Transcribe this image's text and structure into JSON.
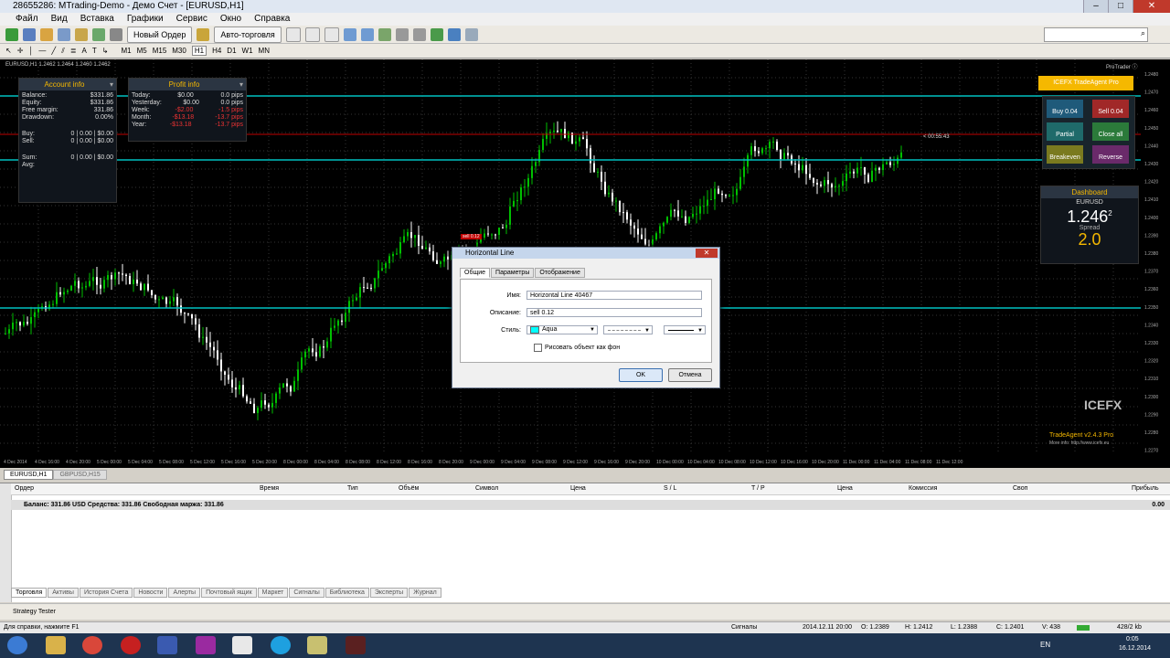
{
  "window": {
    "title": "28655286: MTrading-Demo - Демо Счет - [EURUSD,H1]",
    "min": "–",
    "max": "□",
    "close": "✕"
  },
  "menu": [
    "Файл",
    "Вид",
    "Вставка",
    "Графики",
    "Сервис",
    "Окно",
    "Справка"
  ],
  "toolbar": {
    "new_order": "Новый Ордер",
    "auto_trading": "Авто-торговля"
  },
  "timeframes": [
    "M1",
    "M5",
    "M15",
    "M30",
    "H1",
    "H4",
    "D1",
    "W1",
    "MN"
  ],
  "chart": {
    "symbol_header": "EURUSD,H1 1.2462 1.2464 1.2460 1.2462",
    "pro_trader_label": "ProTrader ⓘ",
    "countdown": "< 00:55:43",
    "price_ticks": [
      "1.2480",
      "1.2470",
      "1.2460",
      "1.2450",
      "1.2440",
      "1.2430",
      "1.2420",
      "1.2410",
      "1.2400",
      "1.2390",
      "1.2380",
      "1.2370",
      "1.2360",
      "1.2350",
      "1.2340",
      "1.2330",
      "1.2320",
      "1.2310",
      "1.2300",
      "1.2290",
      "1.2280",
      "1.2270"
    ],
    "time_ticks": [
      "4 Dec 2014",
      "4 Dec 16:00",
      "4 Dec 20:00",
      "5 Dec 00:00",
      "5 Dec 04:00",
      "5 Dec 08:00",
      "5 Dec 12:00",
      "5 Dec 16:00",
      "5 Dec 20:00",
      "8 Dec 00:00",
      "8 Dec 04:00",
      "8 Dec 08:00",
      "8 Dec 12:00",
      "8 Dec 16:00",
      "8 Dec 20:00",
      "9 Dec 00:00",
      "9 Dec 04:00",
      "9 Dec 08:00",
      "9 Dec 12:00",
      "9 Dec 16:00",
      "9 Dec 20:00",
      "10 Dec 00:00",
      "10 Dec 04:00",
      "10 Dec 08:00",
      "10 Dec 12:00",
      "10 Dec 16:00",
      "10 Dec 20:00",
      "11 Dec 00:00",
      "11 Dec 04:00",
      "11 Dec 08:00",
      "11 Dec 12:00"
    ],
    "line_tag": "sell 0.12",
    "watermark": "ICEFX",
    "tradeagent_version": "TradeAgent v2.4.3 Pro",
    "tradeagent_url": "More info: http://www.icefx.eu",
    "colors": {
      "bull": "#00c000",
      "bear": "#ffffff",
      "hline": "#00c0c0",
      "redline": "#c00000",
      "accent": "#f5b800"
    }
  },
  "account_info": {
    "title": "Account info",
    "rows": [
      {
        "label": "Balance:",
        "value": "$331.86"
      },
      {
        "label": "Equity:",
        "value": "$331.86"
      },
      {
        "label": "Free margin:",
        "value": "331.86"
      },
      {
        "label": "Drawdown:",
        "value": "0.00%"
      }
    ],
    "buy": {
      "label": "Buy:",
      "value": "0 | 0.00 | $0.00"
    },
    "sell": {
      "label": "Sell:",
      "value": "0 | 0.00 | $0.00"
    },
    "sum": {
      "label": "Sum:",
      "value": "0 | 0.00 | $0.00"
    },
    "avg": {
      "label": "Avg:",
      "value": ""
    }
  },
  "profit_info": {
    "title": "Profit info",
    "rows": [
      {
        "label": "Today:",
        "value": "$0.00",
        "pips": "0.0 pips"
      },
      {
        "label": "Yesterday:",
        "value": "$0.00",
        "pips": "0.0 pips"
      },
      {
        "label": "Week:",
        "value": "-$2.00",
        "pips": "-1.5 pips"
      },
      {
        "label": "Month:",
        "value": "-$13.18",
        "pips": "-13.7 pips"
      },
      {
        "label": "Year:",
        "value": "-$13.18",
        "pips": "-13.7 pips"
      }
    ]
  },
  "trade_panel": {
    "header": "ICEFX TradeAgent Pro",
    "buy": "Buy 0.04",
    "sell": "Sell 0.04",
    "partial": "Partial",
    "close_all": "Close all",
    "breakeven": "Breakeven",
    "reverse": "Reverse"
  },
  "dashboard": {
    "title": "Dashboard",
    "symbol": "EURUSD",
    "price": "1.246",
    "price_small": "2",
    "spread_label": "Spread",
    "spread": "2.0"
  },
  "dialog": {
    "title": "Horizontal Line",
    "tabs": [
      "Общие",
      "Параметры",
      "Отображение"
    ],
    "name_label": "Имя:",
    "name_value": "Horizontal Line 40467",
    "desc_label": "Описание:",
    "desc_value": "sell 0.12",
    "style_label": "Стиль:",
    "color_name": "Aqua",
    "background_label": "Рисовать объект как фон",
    "ok": "OK",
    "cancel": "Отмена"
  },
  "chart_tabs": [
    "EURUSD,H1",
    "GBPUSD,H15"
  ],
  "terminal": {
    "columns": [
      "Ордер",
      "Время",
      "Тип",
      "Объём",
      "Символ",
      "Цена",
      "S / L",
      "T / P",
      "Цена",
      "Комиссия",
      "Своп",
      "Прибыль"
    ],
    "balance_line": "Баланс: 331.86 USD  Средства: 331.86  Свободная маржа: 331.86",
    "profit": "0.00",
    "tabs": [
      "Торговля",
      "Активы",
      "История Счета",
      "Новости",
      "Алерты",
      "Почтовый ящик",
      "Маркет",
      "Сигналы",
      "Библиотека",
      "Эксперты",
      "Журнал"
    ],
    "strategy_tester": "Strategy Tester"
  },
  "status": {
    "help": "Для справки, нажмите F1",
    "signals": "Сигналы",
    "datetime": "2014.12.11 20:00",
    "open": "O: 1.2389",
    "high": "H: 1.2412",
    "low": "L: 1.2388",
    "close": "C: 1.2401",
    "volume": "V: 438",
    "traffic": "428/2 kb"
  },
  "taskbar": {
    "lang": "EN",
    "time": "0:05",
    "date": "16.12.2014"
  }
}
